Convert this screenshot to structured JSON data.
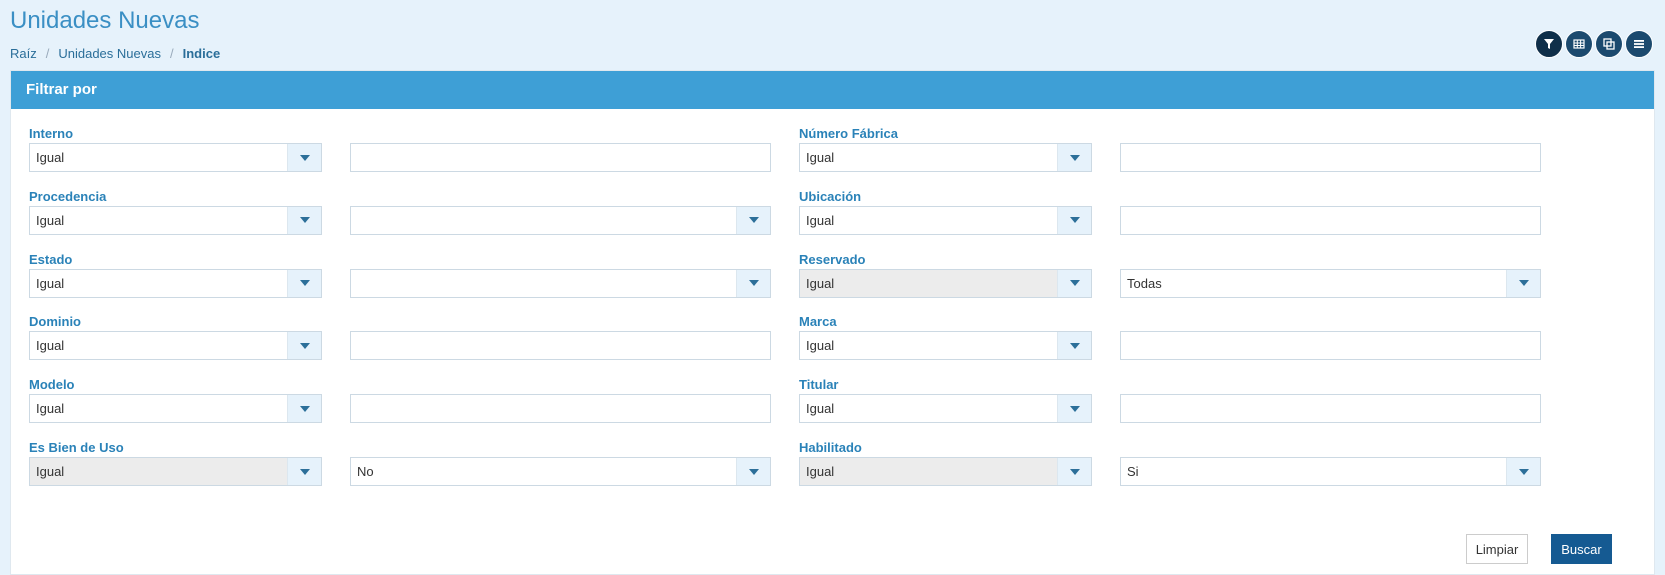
{
  "header": {
    "title": "Unidades Nuevas",
    "breadcrumb": [
      "Raíz",
      "Unidades Nuevas",
      "Indice"
    ]
  },
  "toolbar": {
    "buttons": [
      {
        "name": "filter-icon"
      },
      {
        "name": "grid-icon"
      },
      {
        "name": "copy-icon"
      },
      {
        "name": "menu-icon"
      }
    ]
  },
  "panel": {
    "title": "Filtrar por"
  },
  "filters": {
    "left": [
      {
        "label": "Interno",
        "operator": "Igual",
        "value": "",
        "value_type": "input"
      },
      {
        "label": "Procedencia",
        "operator": "Igual",
        "value": "",
        "value_type": "select"
      },
      {
        "label": "Estado",
        "operator": "Igual",
        "value": "",
        "value_type": "select"
      },
      {
        "label": "Dominio",
        "operator": "Igual",
        "value": "",
        "value_type": "input"
      },
      {
        "label": "Modelo",
        "operator": "Igual",
        "value": "",
        "value_type": "input"
      },
      {
        "label": "Es Bien de Uso",
        "operator": "Igual",
        "value": "No",
        "value_type": "select",
        "operator_disabled": true
      }
    ],
    "right": [
      {
        "label": "Número Fábrica",
        "operator": "Igual",
        "value": "",
        "value_type": "input"
      },
      {
        "label": "Ubicación",
        "operator": "Igual",
        "value": "",
        "value_type": "input"
      },
      {
        "label": "Reservado",
        "operator": "Igual",
        "value": "Todas",
        "value_type": "select",
        "operator_disabled": true
      },
      {
        "label": "Marca",
        "operator": "Igual",
        "value": "",
        "value_type": "input"
      },
      {
        "label": "Titular",
        "operator": "Igual",
        "value": "",
        "value_type": "input"
      },
      {
        "label": "Habilitado",
        "operator": "Igual",
        "value": "Si",
        "value_type": "select",
        "operator_disabled": true
      }
    ]
  },
  "actions": {
    "clear_label": "Limpiar",
    "search_label": "Buscar"
  },
  "colors": {
    "header_bg": "#e6f2fb",
    "panel_heading": "#3e9fd6",
    "label": "#2a82b8",
    "primary_button": "#155a92"
  }
}
